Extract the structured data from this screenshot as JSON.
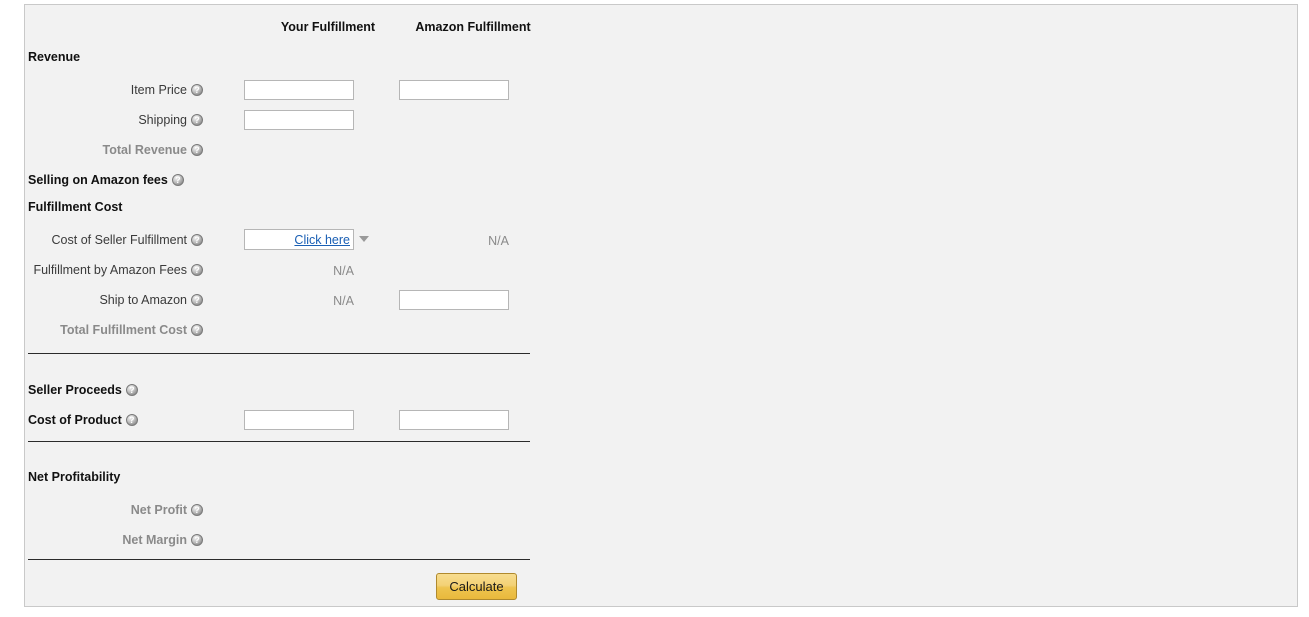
{
  "columns": {
    "your_fulfillment": "Your Fulfillment",
    "amazon_fulfillment": "Amazon Fulfillment"
  },
  "sections": {
    "revenue": "Revenue",
    "selling_fees": "Selling on Amazon fees",
    "fulfillment_cost": "Fulfillment Cost",
    "seller_proceeds": "Seller Proceeds",
    "cost_of_product": "Cost of Product",
    "net_profitability": "Net Profitability"
  },
  "rows": {
    "item_price": "Item Price",
    "shipping": "Shipping",
    "total_revenue": "Total Revenue",
    "cost_of_seller_fulfillment": "Cost of Seller Fulfillment",
    "fba_fees": "Fulfillment by Amazon Fees",
    "ship_to_amazon": "Ship to Amazon",
    "total_fulfillment_cost": "Total Fulfillment Cost",
    "net_profit": "Net Profit",
    "net_margin": "Net Margin"
  },
  "values": {
    "item_price_your": "",
    "item_price_amazon": "",
    "shipping_your": "",
    "cost_seller_fulfillment_link": "Click here",
    "cost_seller_fulfillment_amazon": "N/A",
    "fba_fees_your": "N/A",
    "ship_to_amazon_your": "N/A",
    "ship_to_amazon_amazon": "",
    "cost_of_product_your": "",
    "cost_of_product_amazon": ""
  },
  "buttons": {
    "calculate": "Calculate"
  },
  "colors": {
    "panel_bg": "#f2f2f2",
    "panel_border": "#c9c9c9",
    "link": "#1a5fb4",
    "muted_text": "#8a8a8a",
    "button_gold": "#eec44f",
    "button_border": "#b08a2e",
    "divider": "#2b2b2b"
  }
}
